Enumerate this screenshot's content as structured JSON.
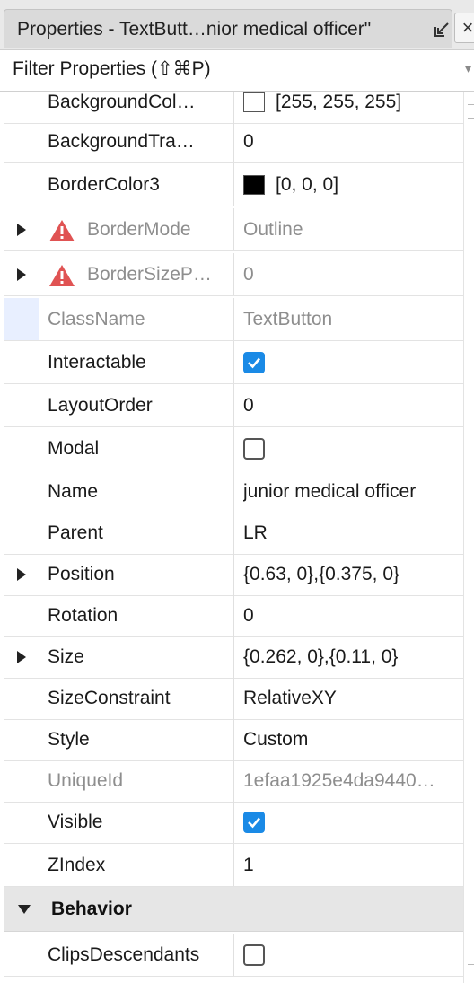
{
  "titlebar": {
    "title": "Properties - TextButt…nior medical officer\"",
    "undock_icon": "undock-arrow-icon",
    "close_glyph": "×"
  },
  "filter": {
    "placeholder": "Filter Properties (⇧⌘P)",
    "caret_glyph": "▾"
  },
  "rows": [
    {
      "name": "BackgroundCol…",
      "value": "[255, 255, 255]",
      "kind": "color",
      "color": "#ffffff"
    },
    {
      "name": "BackgroundTra…",
      "value": "0"
    },
    {
      "name": "BorderColor3",
      "value": "[0, 0, 0]",
      "kind": "color",
      "color": "#000000"
    },
    {
      "name": "BorderMode",
      "value": "Outline",
      "expandable": true,
      "warning": true,
      "disabled": true
    },
    {
      "name": "BorderSizeP…",
      "value": "0",
      "expandable": true,
      "warning": true,
      "disabled": true
    },
    {
      "name": "ClassName",
      "value": "TextButton",
      "disabled": true,
      "selected": true
    },
    {
      "name": "Interactable",
      "kind": "checkbox",
      "checked": true
    },
    {
      "name": "LayoutOrder",
      "value": "0"
    },
    {
      "name": "Modal",
      "kind": "checkbox",
      "checked": false
    },
    {
      "name": "Name",
      "value": "junior medical officer"
    },
    {
      "name": "Parent",
      "value": "LR"
    },
    {
      "name": "Position",
      "value": "{0.63, 0},{0.375, 0}",
      "expandable": true
    },
    {
      "name": "Rotation",
      "value": "0"
    },
    {
      "name": "Size",
      "value": "{0.262, 0},{0.11, 0}",
      "expandable": true
    },
    {
      "name": "SizeConstraint",
      "value": "RelativeXY"
    },
    {
      "name": "Style",
      "value": "Custom"
    },
    {
      "name": "UniqueId",
      "value": "1efaa1925e4da9440…",
      "disabled": true
    },
    {
      "name": "Visible",
      "kind": "checkbox",
      "checked": true
    },
    {
      "name": "ZIndex",
      "value": "1"
    }
  ],
  "section": {
    "label": "Behavior"
  },
  "section_rows": [
    {
      "name": "ClipsDescendants",
      "kind": "checkbox",
      "checked": false
    }
  ],
  "colors": {
    "accent": "#1a8ae6",
    "warning": "#e05353",
    "disabled_text": "#8e8e8e"
  }
}
